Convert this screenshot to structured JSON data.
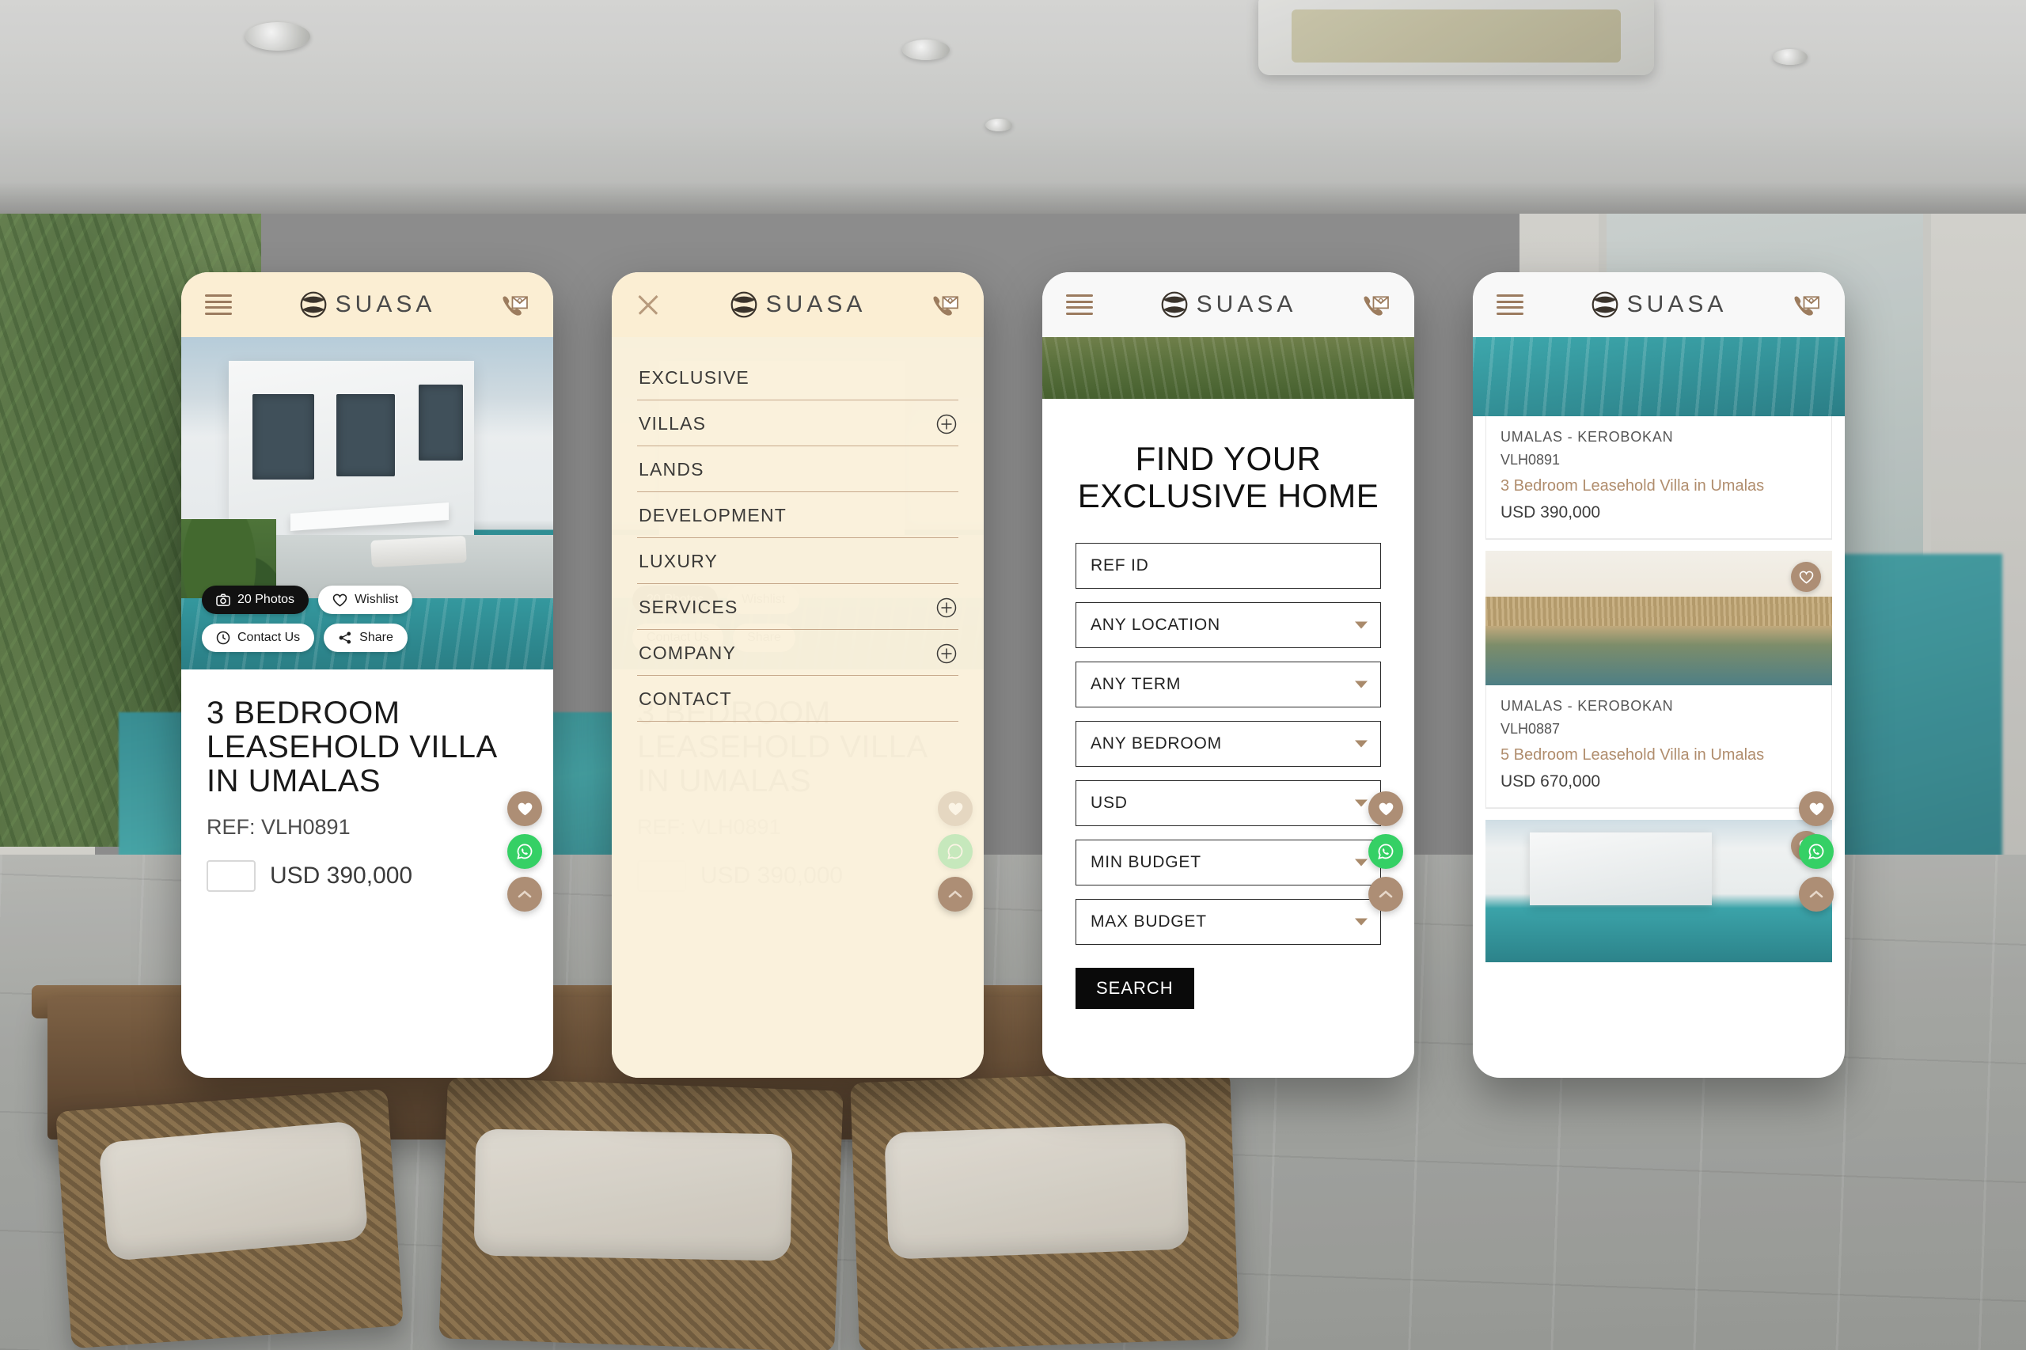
{
  "brand": {
    "name": "SUASA",
    "logo_icon": "suasa-sphere-logo",
    "menu_icon": "hamburger-menu-icon",
    "close_icon": "close-x-icon",
    "contact_icon": "phone-envelope-icon",
    "accent_tan": "#ad8e75",
    "accent_cream": "#fbeed3",
    "accent_gold": "#b08d6d",
    "whatsapp_green": "#35d065"
  },
  "panel1": {
    "hero_buttons": [
      {
        "label": "20 Photos",
        "icon": "camera-icon",
        "style": "dark"
      },
      {
        "label": "Wishlist",
        "icon": "heart-icon",
        "style": "light"
      },
      {
        "label": "Contact Us",
        "icon": "clock-icon",
        "style": "light"
      },
      {
        "label": "Share",
        "icon": "share-icon",
        "style": "light"
      }
    ],
    "property": {
      "title": "3 BEDROOM LEASEHOLD VILLA IN UMALAS",
      "ref": "REF: VLH0891",
      "price": "USD 390,000"
    }
  },
  "panel2": {
    "menu": [
      {
        "label": "EXCLUSIVE",
        "expandable": false
      },
      {
        "label": "VILLAS",
        "expandable": true
      },
      {
        "label": "LANDS",
        "expandable": false
      },
      {
        "label": "DEVELOPMENT",
        "expandable": false
      },
      {
        "label": "LUXURY",
        "expandable": false
      },
      {
        "label": "SERVICES",
        "expandable": true
      },
      {
        "label": "COMPANY",
        "expandable": true
      },
      {
        "label": "CONTACT",
        "expandable": false
      }
    ]
  },
  "panel3": {
    "search_title": "FIND YOUR EXCLUSIVE HOME",
    "fields": [
      {
        "label": "REF ID",
        "type": "text"
      },
      {
        "label": "ANY LOCATION",
        "type": "select"
      },
      {
        "label": "ANY TERM",
        "type": "select"
      },
      {
        "label": "ANY BEDROOM",
        "type": "select"
      },
      {
        "label": "USD",
        "type": "select"
      },
      {
        "label": "MIN BUDGET",
        "type": "select"
      },
      {
        "label": "MAX BUDGET",
        "type": "select"
      }
    ],
    "search_button": "SEARCH"
  },
  "panel4": {
    "listings": [
      {
        "location": "UMALAS - KEROBOKAN",
        "ref": "VLH0891",
        "name": "3 Bedroom Leasehold Villa in Umalas",
        "price": "USD 390,000"
      },
      {
        "location": "UMALAS - KEROBOKAN",
        "ref": "VLH0887",
        "name": "5 Bedroom Leasehold Villa in Umalas",
        "price": "USD 670,000"
      }
    ]
  },
  "fabs": [
    {
      "name": "wishlist",
      "icon": "heart-icon"
    },
    {
      "name": "whatsapp",
      "icon": "whatsapp-icon"
    },
    {
      "name": "scroll-top",
      "icon": "chevron-up-icon"
    }
  ]
}
